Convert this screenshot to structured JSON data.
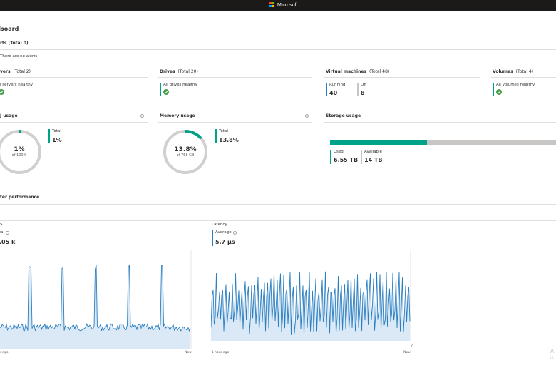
{
  "topbar": {
    "brand": "Microsoft"
  },
  "page": {
    "title": "board"
  },
  "alerts": {
    "title": "rts (Total 0)",
    "message": "There are no alerts"
  },
  "servers": {
    "title": "vers",
    "count": "(Total 2)",
    "status": "l servers healthy"
  },
  "drives": {
    "title": "Drives",
    "count": "(Total 20)",
    "status": "All drives healthy"
  },
  "vms": {
    "title": "Virtual machines",
    "count": "(Total 48)",
    "running_label": "Running",
    "running_value": "40",
    "off_label": "Off",
    "off_value": "8"
  },
  "volumes": {
    "title": "Volumes",
    "count": "(Total 4)",
    "status": "All volumes healthy"
  },
  "cpu": {
    "title": "J usage",
    "percent": "1%",
    "of": "of 100%",
    "total_label": "Total",
    "total_value": "1%",
    "fraction": 0.01
  },
  "memory": {
    "title": "Memory usage",
    "percent": "13.8%",
    "of": "of 768 GB",
    "total_label": "Total",
    "total_value": "13.8%",
    "fraction": 0.138
  },
  "storage": {
    "title": "Storage usage",
    "used_label": "Used",
    "used_value": "6.55 TB",
    "available_label": "Available",
    "available_value": "14 TB",
    "fraction": 0.43
  },
  "performance": {
    "title": "ter performance"
  },
  "iops": {
    "title": "S",
    "total_label": "tal",
    "value": ".05 k",
    "x_start": "r ago",
    "x_end": "Now"
  },
  "latency": {
    "title": "Latency",
    "avg_label": "Average",
    "value": "5.7 µs",
    "x_start": "1 hour ago",
    "x_end": "Now",
    "y_min": "0"
  },
  "watermark": {
    "line1": "A",
    "line2": "G"
  },
  "colors": {
    "accent": "#00a388",
    "chart": "#2a7fc1",
    "healthy": "#4a9e4a",
    "track": "#d2d0ce"
  }
}
